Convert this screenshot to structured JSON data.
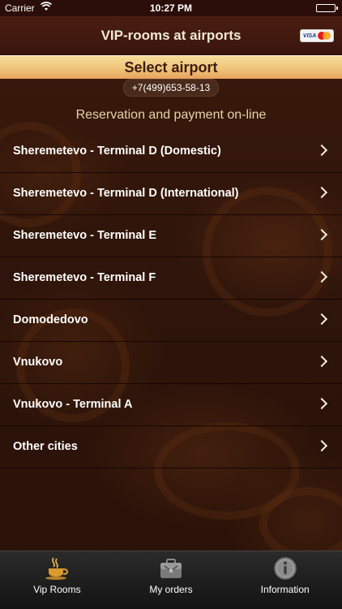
{
  "status_bar": {
    "carrier": "Carrier",
    "time": "10:27 PM"
  },
  "nav": {
    "title": "VIP-rooms at airports",
    "cards_label": "VISA"
  },
  "section": {
    "title": "Select airport"
  },
  "phone": "+7(499)653-58-13",
  "subtitle": "Reservation and payment on-line",
  "airports": [
    "Sheremetevo - Terminal D (Domestic)",
    "Sheremetevo - Terminal D (International)",
    "Sheremetevo - Terminal E",
    "Sheremetevo - Terminal F",
    "Domodedovo",
    "Vnukovo",
    "Vnukovo - Terminal A",
    "Other cities"
  ],
  "tabs": [
    {
      "label": "Vip Rooms",
      "icon": "coffee-cup-icon"
    },
    {
      "label": "My orders",
      "icon": "briefcase-icon"
    },
    {
      "label": "Information",
      "icon": "info-icon"
    }
  ],
  "colors": {
    "background": "#2a1208",
    "navbar": "#3a150c",
    "section_header": "#f0c47a",
    "tabbar": "#1b1b1b"
  }
}
